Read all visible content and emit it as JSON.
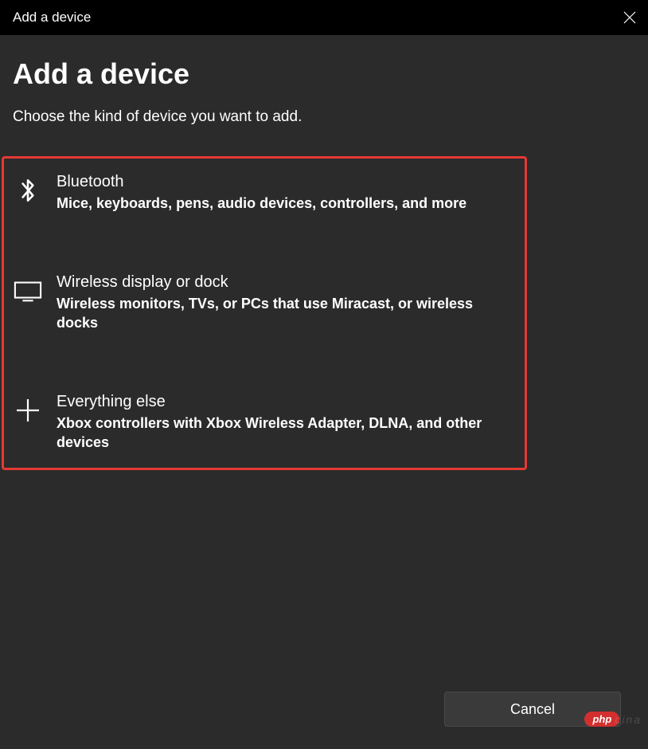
{
  "titlebar": {
    "title": "Add a device"
  },
  "heading": "Add a device",
  "subtitle": "Choose the kind of device you want to add.",
  "options": [
    {
      "icon": "bluetooth",
      "title": "Bluetooth",
      "description": "Mice, keyboards, pens, audio devices, controllers, and more"
    },
    {
      "icon": "display",
      "title": "Wireless display or dock",
      "description": "Wireless monitors, TVs, or PCs that use Miracast, or wireless docks"
    },
    {
      "icon": "plus",
      "title": "Everything else",
      "description": "Xbox controllers with Xbox Wireless Adapter, DLNA, and other devices"
    }
  ],
  "footer": {
    "cancel": "Cancel"
  },
  "watermark": {
    "pill": "php",
    "suffix": "cina"
  }
}
